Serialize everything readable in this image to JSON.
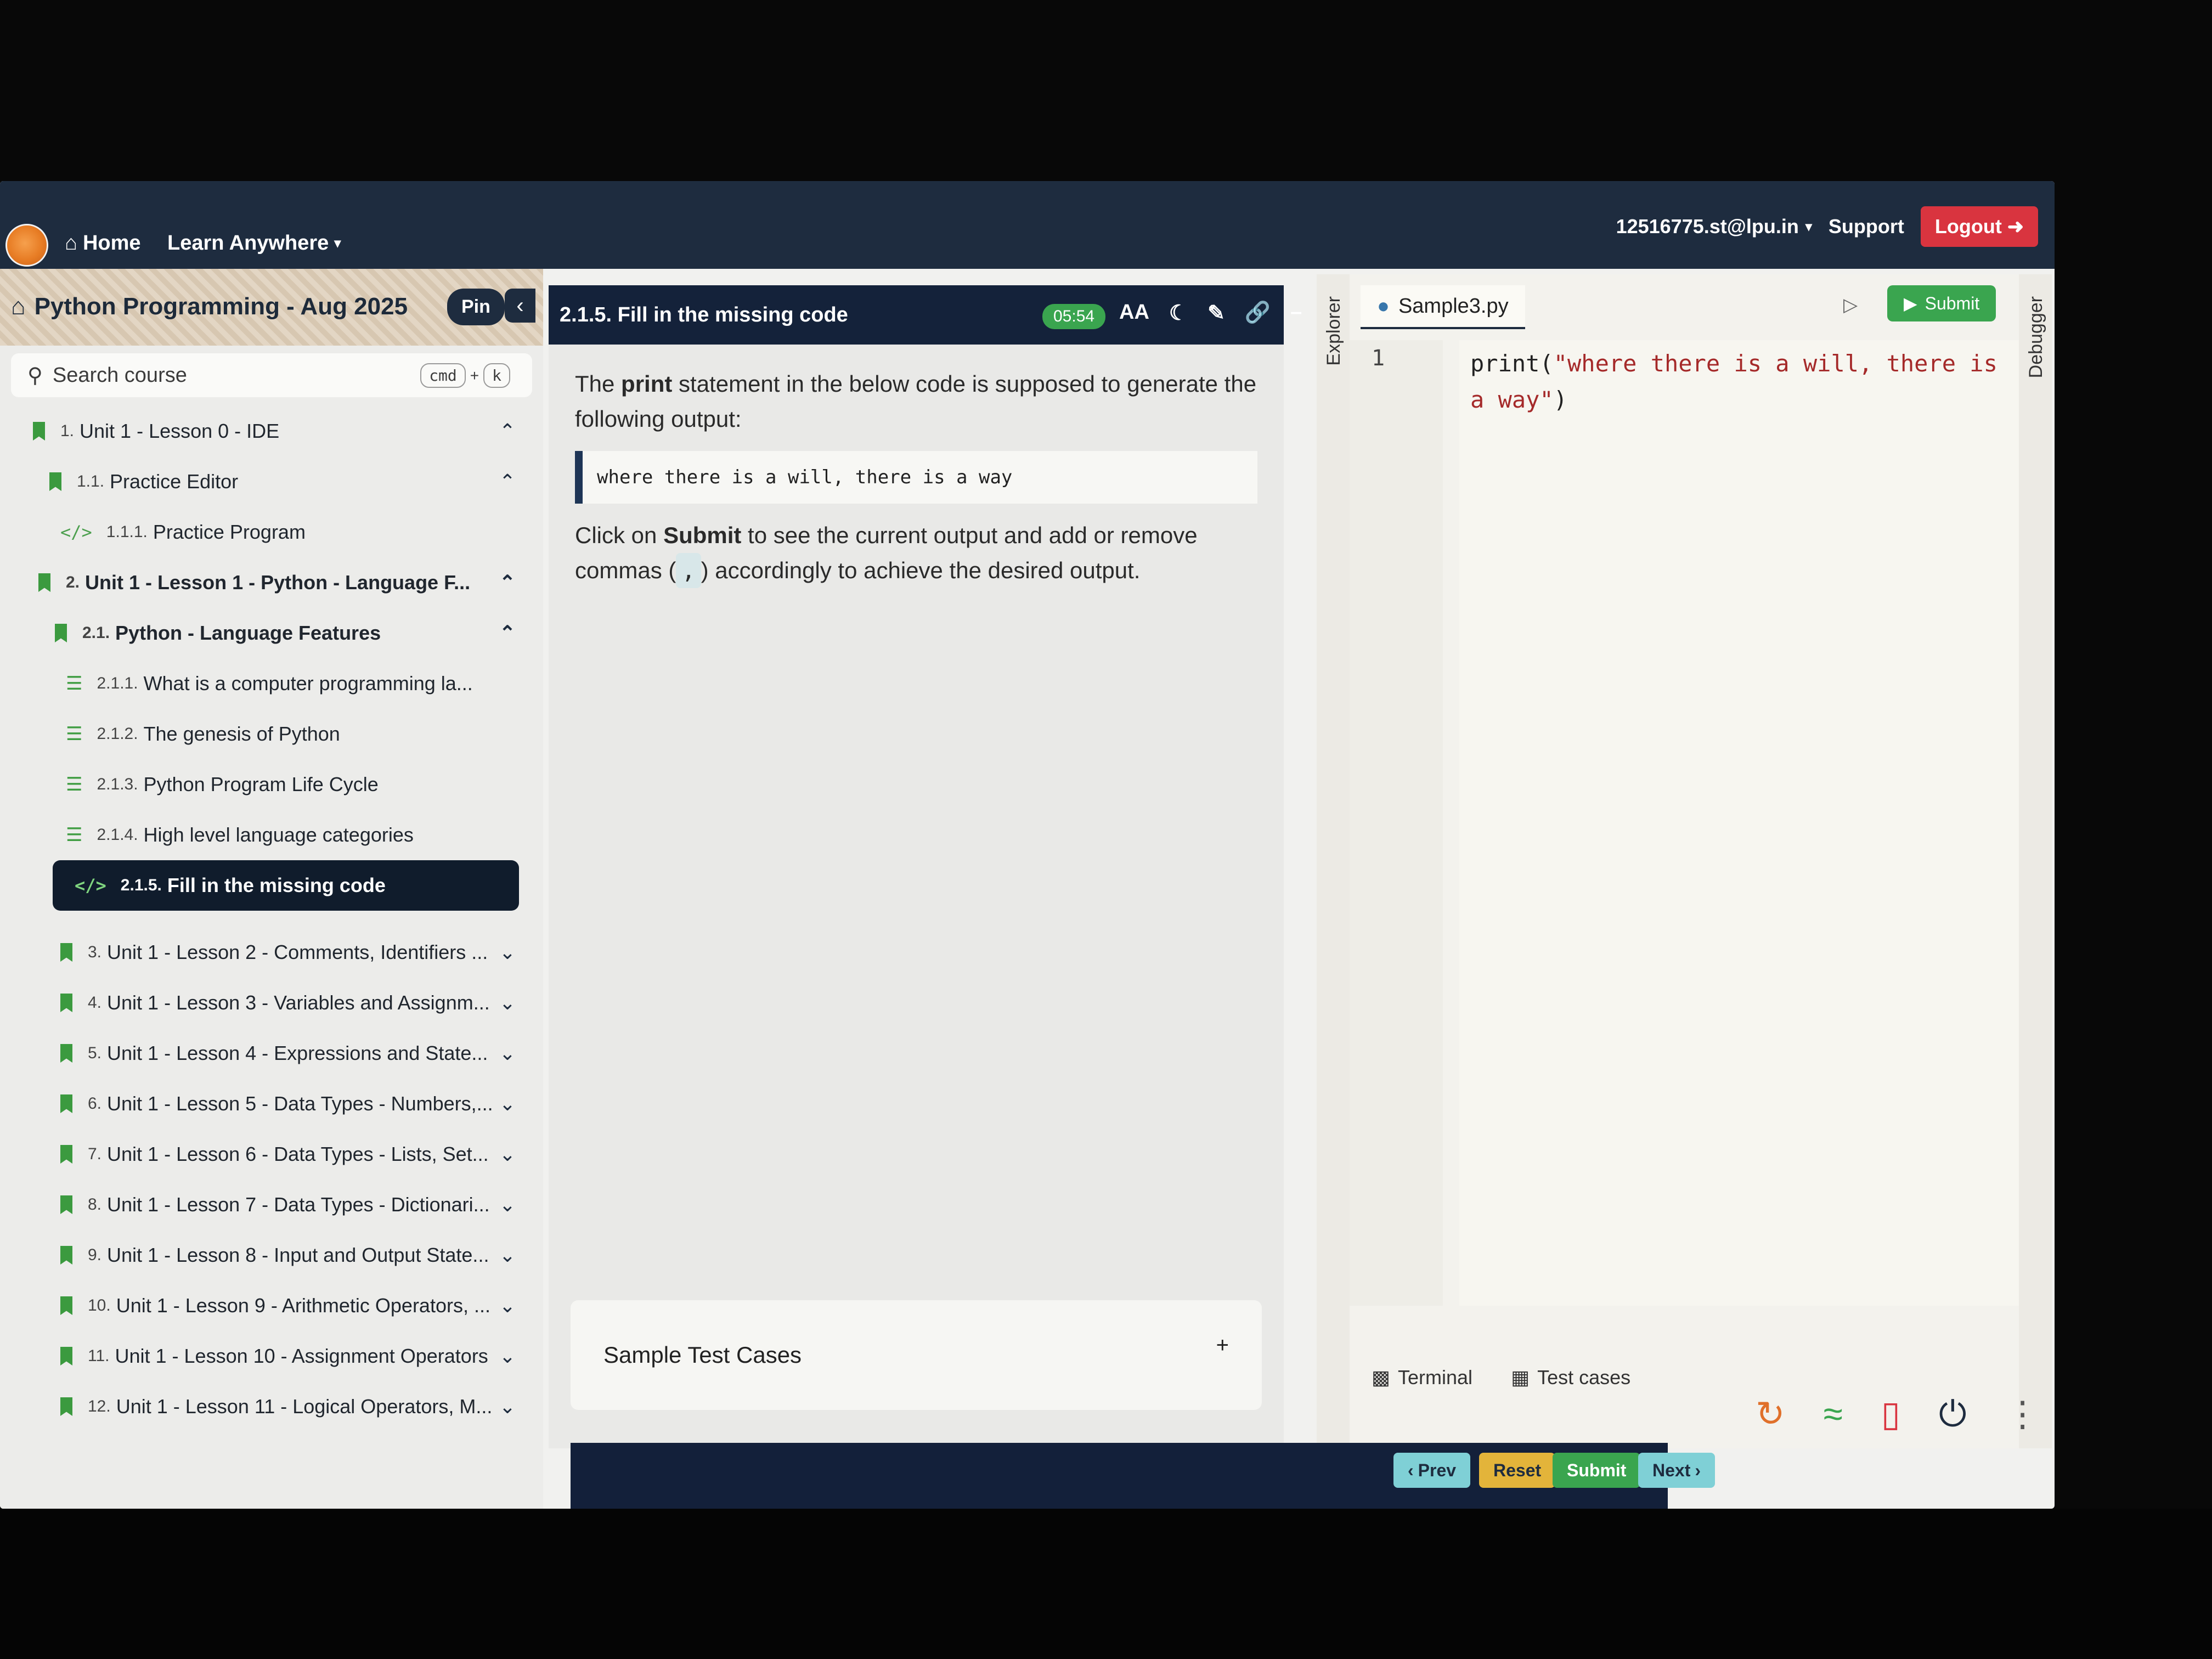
{
  "topbar": {
    "home_label": "Home",
    "learn_label": "Learn Anywhere",
    "user_email": "12516775.st@lpu.in",
    "support_label": "Support",
    "logout_label": "Logout"
  },
  "sidebar": {
    "course_title": "Python Programming - Aug 2025",
    "pin_label": "Pin",
    "search_placeholder": "Search course",
    "shortcut": {
      "key1": "cmd",
      "plus": "+",
      "key2": "k"
    },
    "items": [
      {
        "num": "1.",
        "label": "Unit 1 - Lesson 0 - IDE",
        "level": 0,
        "expanded": true
      },
      {
        "num": "1.1.",
        "label": "Practice Editor",
        "level": 1,
        "expanded": true
      },
      {
        "num": "1.1.1.",
        "label": "Practice Program",
        "level": 2,
        "icon": "code-icon"
      },
      {
        "num": "2.",
        "label": "Unit 1 - Lesson 1 - Python - Language F...",
        "level": 0,
        "expanded": true,
        "bold": true
      },
      {
        "num": "2.1.",
        "label": "Python - Language Features",
        "level": 1,
        "expanded": true,
        "bold": true
      },
      {
        "num": "2.1.1.",
        "label": "What is a computer programming la...",
        "level": 2,
        "icon": "list-icon"
      },
      {
        "num": "2.1.2.",
        "label": "The genesis of Python",
        "level": 2,
        "icon": "list-icon"
      },
      {
        "num": "2.1.3.",
        "label": "Python Program Life Cycle",
        "level": 2,
        "icon": "list-icon"
      },
      {
        "num": "2.1.4.",
        "label": "High level language categories",
        "level": 2,
        "icon": "list-icon"
      },
      {
        "num": "2.1.5.",
        "label": "Fill in the missing code",
        "level": 2,
        "icon": "code-icon",
        "active": true
      },
      {
        "num": "3.",
        "label": "Unit 1 - Lesson 2 - Comments, Identifiers ...",
        "level": 0
      },
      {
        "num": "4.",
        "label": "Unit 1 - Lesson 3 - Variables and Assignm...",
        "level": 0
      },
      {
        "num": "5.",
        "label": "Unit 1 - Lesson 4 - Expressions and State...",
        "level": 0
      },
      {
        "num": "6.",
        "label": "Unit 1 - Lesson 5 - Data Types - Numbers,...",
        "level": 0
      },
      {
        "num": "7.",
        "label": "Unit 1 - Lesson 6 - Data Types - Lists, Set...",
        "level": 0
      },
      {
        "num": "8.",
        "label": "Unit 1 - Lesson 7 - Data Types - Dictionari...",
        "level": 0
      },
      {
        "num": "9.",
        "label": "Unit 1 - Lesson 8 - Input and Output State...",
        "level": 0
      },
      {
        "num": "10.",
        "label": "Unit 1 - Lesson 9 - Arithmetic Operators, ...",
        "level": 0
      },
      {
        "num": "11.",
        "label": "Unit 1 - Lesson 10 - Assignment Operators",
        "level": 0
      },
      {
        "num": "12.",
        "label": "Unit 1 - Lesson 11 - Logical Operators, M...",
        "level": 0
      }
    ]
  },
  "content": {
    "title": "2.1.5. Fill in the missing code",
    "timer": "05:54",
    "font_icon_label": "AA",
    "para1_pre": "The ",
    "para1_bold": "print",
    "para1_post": " statement in the below code is supposed to generate the following output:",
    "expected_output": "where there is a will, there is a way",
    "para2_pre": "Click on ",
    "para2_bold": "Submit",
    "para2_mid": " to see the current output and add or remove commas (",
    "para2_chip": ",",
    "para2_post": ") accordingly to achieve the desired output.",
    "test_cases_label": "Sample Test Cases",
    "test_cases_plus": "+"
  },
  "editor": {
    "explorer_label": "Explorer",
    "debugger_label": "Debugger",
    "file_tab": "Sample3.py",
    "submit_label": "Submit",
    "line_number": "1",
    "code_fn": "print(",
    "code_string": "\"where there is a will, there is a way\"",
    "code_close": ")",
    "terminal_label": "Terminal",
    "testcases_label": "Test cases"
  },
  "footer": {
    "prev_label": "Prev",
    "reset_label": "Reset",
    "submit_label": "Submit",
    "next_label": "Next"
  },
  "colors": {
    "navy": "#1e2c3f",
    "green": "#3aa54f",
    "logout_red": "#d9343f",
    "reset_yellow": "#e3b43a",
    "next_teal": "#7fd0d6"
  }
}
